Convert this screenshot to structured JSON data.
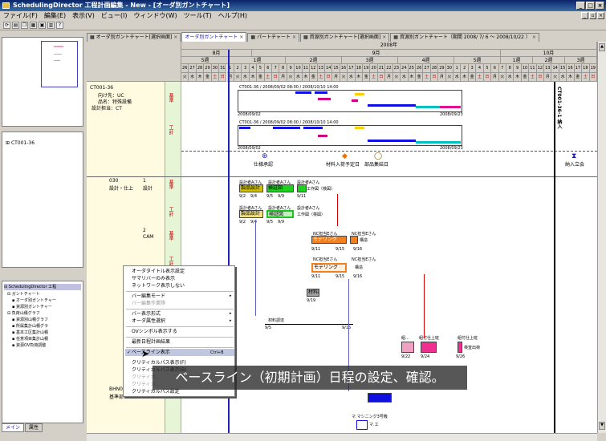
{
  "window": {
    "title": "SchedulingDirector 工程計画編集 - New - [オーダ別ガントチャート]"
  },
  "menu": [
    "ファイル(F)",
    "編集(E)",
    "表示(V)",
    "ビュー(I)",
    "ウィンドウ(W)",
    "ツール(T)",
    "ヘルプ(H)"
  ],
  "tabs": [
    {
      "label": "オーダ別ガントチャート[選択画面]",
      "active": false
    },
    {
      "label": "オーダ別ガントチャート",
      "active": true
    },
    {
      "label": "パートチャート",
      "active": false
    },
    {
      "label": "資源別ガントチャート[選択画面]",
      "active": false
    },
    {
      "label": "資源別ガントチャート（期間 2008/ 7/ 6 ～ 2008/10/22 ）",
      "active": false
    }
  ],
  "sidebar": {
    "tree_item": "CT001-36",
    "nav_root": "SchedulingDirector 工程",
    "nav_items": [
      "ガントチャート",
      "オーダ別ガントチャー",
      "資源別ガントチャー",
      "負荷山積グラフ",
      "資源別山積グラフ",
      "所属集計山積グラ",
      "基本工区集計山積",
      "任意項目集計山積",
      "資源OV負荷調整"
    ],
    "bottom_tabs": [
      "メイン",
      "属性"
    ]
  },
  "timeline": {
    "year": "2008年",
    "months": [
      "8月",
      "9月",
      "10月"
    ],
    "weeks": [
      "5週",
      "1週",
      "2週",
      "3週",
      "4週",
      "5週",
      "1週",
      "2週",
      "3週"
    ],
    "days": [
      "26",
      "27",
      "28",
      "29",
      "30",
      "31",
      "1",
      "2",
      "3",
      "4",
      "5",
      "6",
      "7",
      "8",
      "9",
      "10",
      "11",
      "12",
      "13",
      "14",
      "15",
      "16",
      "17",
      "18",
      "19",
      "20",
      "21",
      "22",
      "23",
      "24",
      "25",
      "26",
      "27",
      "28",
      "29",
      "30",
      "1",
      "2",
      "3",
      "4",
      "5",
      "6",
      "7",
      "8",
      "9",
      "10",
      "11",
      "12",
      "13",
      "14",
      "15",
      "16",
      "17",
      "18",
      "19"
    ]
  },
  "order": {
    "id": "CT001-36",
    "dest_label": "向け先：UC",
    "product_label": "品名：特殊設備",
    "owner_label": "設計担当：CT",
    "rows": [
      "基準",
      "工計"
    ],
    "detail_1": "CT001-36 / 2008/09/02 08:00 / 2008/10/10 14:00",
    "date_1": "2008/09/02",
    "date_2": "2008/09/23",
    "detail_2": "CT001-36 / 2008/09/02 08:00 / 2008/10/10 14:00",
    "vert_label": "CT001-36-1 納入"
  },
  "milestones": [
    "仕様承認",
    "材料入荷予定日",
    "部品集結日",
    "納入立会"
  ],
  "sections": [
    {
      "code": "030",
      "name": "設計・仕上",
      "sub": "1",
      "subname": "設計"
    },
    {
      "code": "",
      "name": "",
      "sub": "2",
      "subname": "CAM"
    }
  ],
  "tasks": {
    "a1": "製品設計",
    "a1_owner": "設計者Aさん",
    "a2": "検証図",
    "a2_owner": "設計者Aさん",
    "a3": "工作図（検図）",
    "a3_owner": "設計者Aさん",
    "d1": "9/2",
    "d2": "9/4",
    "d3": "9/5",
    "d4": "9/9",
    "d5": "9/11",
    "b1": "モデリング",
    "b1_owner": "NC担当Eさん",
    "b2": "構造",
    "b2_owner": "NC担当Eさん",
    "d6": "9/11",
    "d7": "9/15",
    "d8": "9/16",
    "c1": "材料調達",
    "c2": "材料調達",
    "c3": "組...",
    "c4": "組付仕上班",
    "c5": "組付仕上班",
    "c6": "検査出荷",
    "d9": "9/19",
    "d10": "9/5",
    "d11": "9/15",
    "d12": "9/22",
    "d13": "9/24",
    "d14": "9/26",
    "lower1": "BHN001",
    "lower2": "基準部",
    "lower3": "マ.マシニング3号機",
    "lower4": "マ.工"
  },
  "context_menu": {
    "items": [
      {
        "label": "オーダタイトル表示設定",
        "disabled": false
      },
      {
        "label": "サマリバーのみ表示",
        "disabled": false
      },
      {
        "label": "ネットワーク表示しない",
        "disabled": false
      },
      {
        "label": "バー編集モード",
        "disabled": false,
        "sub": true
      },
      {
        "label": "バー編集作業隊",
        "disabled": true
      },
      {
        "label": "バー表示形式",
        "disabled": false,
        "sub": true
      },
      {
        "label": "オーダ属性選択",
        "disabled": false,
        "sub": true
      },
      {
        "label": "OVシンボル表示する",
        "disabled": false
      },
      {
        "label": "最新日程計画結果",
        "disabled": false
      },
      {
        "label": "ベースライン表示",
        "disabled": false,
        "shortcut": "Ctrl+B",
        "checked": true
      },
      {
        "label": "クリティカルパス表示(F)",
        "disabled": false
      },
      {
        "label": "クリティカルパス表示(B)",
        "disabled": false
      },
      {
        "label": "クリティカ...",
        "disabled": true
      },
      {
        "label": "クリティカ...",
        "disabled": true
      },
      {
        "label": "クリティカルパス設定",
        "disabled": false
      }
    ]
  },
  "caption": "ベースライン（初期計画）日程の設定、確認。"
}
